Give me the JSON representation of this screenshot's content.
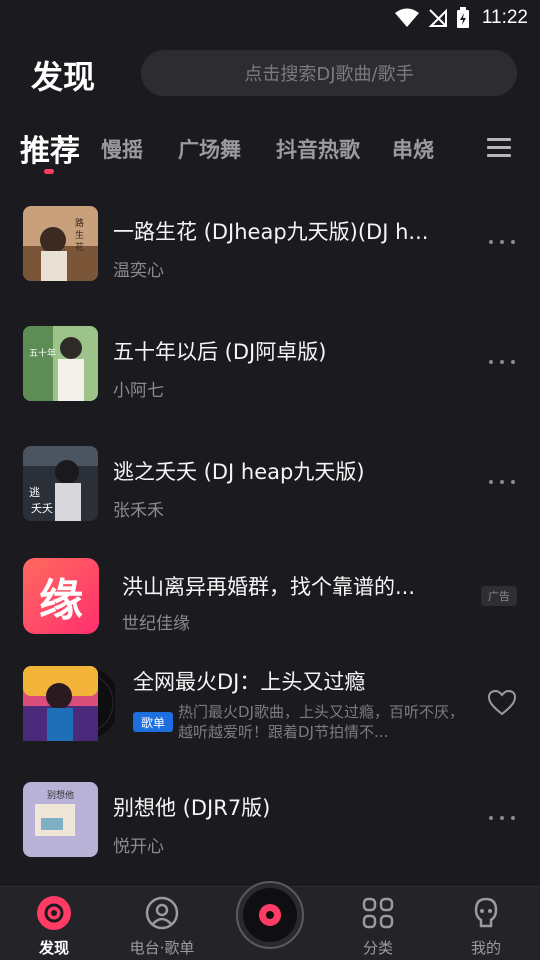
{
  "status": {
    "time": "11:22"
  },
  "header": {
    "title": "发现",
    "search_placeholder": "点击搜索DJ歌曲/歌手"
  },
  "tabs": [
    {
      "label": "推荐",
      "active": true
    },
    {
      "label": "慢摇"
    },
    {
      "label": "广场舞"
    },
    {
      "label": "抖音热歌"
    },
    {
      "label": "串烧"
    }
  ],
  "songs": [
    {
      "title": "一路生花 (DJheap九天版)(DJ h...",
      "artist": "温奕心"
    },
    {
      "title": "五十年以后 (DJ阿卓版)",
      "artist": "小阿七"
    },
    {
      "title": "逃之夭夭 (DJ heap九天版)",
      "artist": "张禾禾"
    },
    {
      "title": "洪山离异再婚群，找个靠谱的...",
      "artist": "世纪佳缘",
      "ad_badge": "广告"
    },
    {
      "title": "全网最火DJ：上头又过瘾",
      "tag": "歌单",
      "desc": "热门最火DJ歌曲，上头又过瘾，百听不厌，越听越爱听！跟着DJ节拍情不..."
    },
    {
      "title": "别想他 (DJR7版)",
      "artist": "悦开心"
    }
  ],
  "ad_logo_text": "缘",
  "nav": [
    {
      "label": "发现",
      "active": true
    },
    {
      "label": "电台·歌单"
    },
    {
      "label": "分类"
    },
    {
      "label": "我的"
    }
  ],
  "colors": {
    "accent": "#ff3b66",
    "background": "#1b1b1f",
    "tag_blue": "#1d6fe0"
  }
}
